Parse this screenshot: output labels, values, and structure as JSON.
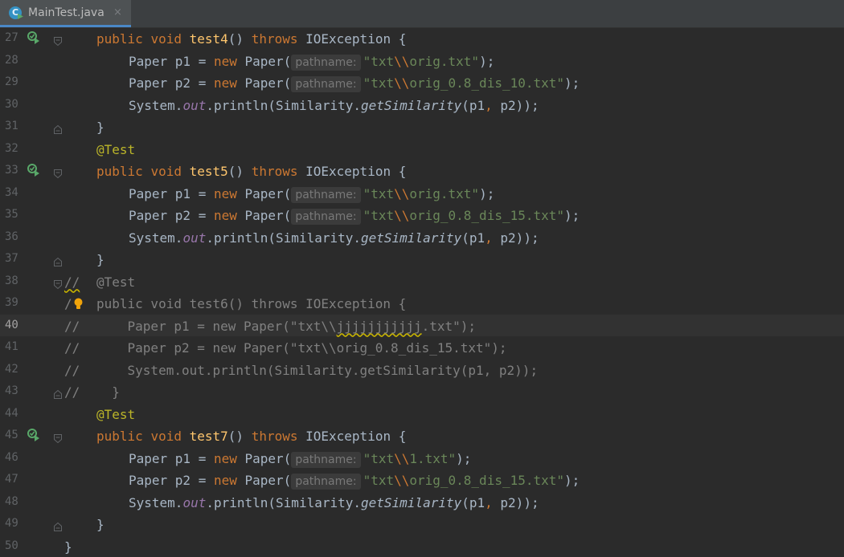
{
  "tab": {
    "label": "MainTest.java",
    "close": "×",
    "icon": "java-class-icon",
    "icon_letter": "C"
  },
  "param_hint": "pathname:",
  "lines": [
    {
      "n": "27",
      "a": "public",
      "b": "void",
      "c": "test4",
      "d": "()",
      "e": "throws",
      "f": "IOException {"
    },
    {
      "n": "28",
      "t": "Paper p1 = ",
      "k": "new",
      "u": " Paper(",
      "s": "\"txt",
      "esc": "\\\\",
      "s2": "orig.txt\"",
      "end": ");"
    },
    {
      "n": "29",
      "t": "Paper p2 = ",
      "k": "new",
      "u": " Paper(",
      "s": "\"txt",
      "esc": "\\\\",
      "s2": "orig_0.8_dis_10.txt\"",
      "end": ");"
    },
    {
      "n": "30",
      "sys": "System.",
      "out": "out",
      "pr": ".println(Similarity.",
      "gs": "getSimilarity",
      "args": "(p1",
      "comma": ",",
      "rest": " p2));"
    },
    {
      "n": "31",
      "brace": "}"
    },
    {
      "n": "32",
      "ann": "@Test"
    },
    {
      "n": "33",
      "a": "public",
      "b": "void",
      "c": "test5",
      "d": "()",
      "e": "throws",
      "f": "IOException {"
    },
    {
      "n": "34",
      "t": "Paper p1 = ",
      "k": "new",
      "u": " Paper(",
      "s": "\"txt",
      "esc": "\\\\",
      "s2": "orig.txt\"",
      "end": ");"
    },
    {
      "n": "35",
      "t": "Paper p2 = ",
      "k": "new",
      "u": " Paper(",
      "s": "\"txt",
      "esc": "\\\\",
      "s2": "orig_0.8_dis_15.txt\"",
      "end": ");"
    },
    {
      "n": "36",
      "sys": "System.",
      "out": "out",
      "pr": ".println(Similarity.",
      "gs": "getSimilarity",
      "args": "(p1",
      "comma": ",",
      "rest": " p2));"
    },
    {
      "n": "37",
      "brace": "}"
    },
    {
      "n": "38",
      "gc": "//",
      "c1": "@Test"
    },
    {
      "n": "39",
      "gc": "/",
      "c1": "public void test6() throws IOException {"
    },
    {
      "n": "40",
      "gc": "//",
      "c1a": "    Paper p1 = new Paper(\"txt\\\\",
      "c1b": "jjjjjjjjjjj",
      "c1c": ".txt\");"
    },
    {
      "n": "41",
      "gc": "//",
      "c1": "    Paper p2 = new Paper(\"txt\\\\orig_0.8_dis_15.txt\");"
    },
    {
      "n": "42",
      "gc": "//",
      "c1": "    System.out.println(Similarity.getSimilarity(p1, p2));"
    },
    {
      "n": "43",
      "gc": "//",
      "c1": "  }"
    },
    {
      "n": "44",
      "ann": "@Test"
    },
    {
      "n": "45",
      "a": "public",
      "b": "void",
      "c": "test7",
      "d": "()",
      "e": "throws",
      "f": "IOException {"
    },
    {
      "n": "46",
      "t": "Paper p1 = ",
      "k": "new",
      "u": " Paper(",
      "s": "\"txt",
      "esc": "\\\\",
      "s2": "1.txt\"",
      "end": ");"
    },
    {
      "n": "47",
      "t": "Paper p2 = ",
      "k": "new",
      "u": " Paper(",
      "s": "\"txt",
      "esc": "\\\\",
      "s2": "orig_0.8_dis_15.txt\"",
      "end": ");"
    },
    {
      "n": "48",
      "sys": "System.",
      "out": "out",
      "pr": ".println(Similarity.",
      "gs": "getSimilarity",
      "args": "(p1",
      "comma": ",",
      "rest": " p2));"
    },
    {
      "n": "49",
      "brace": "}"
    },
    {
      "n": "50",
      "cbrace": "}"
    }
  ],
  "colors": {
    "background": "#2b2b2b",
    "keyword": "#cc7832",
    "method": "#ffc66d",
    "string": "#6a8759",
    "annotation": "#bbb529",
    "field": "#9876aa",
    "comment": "#808080",
    "text": "#a9b7c6",
    "run": "#59a869"
  }
}
